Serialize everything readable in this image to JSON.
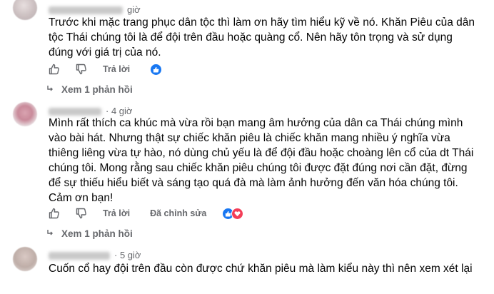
{
  "comments": [
    {
      "time": "giờ",
      "text": "Trước khi mặc trang phục dân tộc thì làm ơn hãy tìm hiểu kỹ về nó. Khăn Piêu của dân\ntộc Thái chúng tôi là để đội trên đầu hoặc quàng cổ. Nên hãy tôn trọng và sử dụng\nđúng với giá trị của nó.",
      "reply_label": "Trả lời",
      "view_replies": "Xem 1 phản hồi"
    },
    {
      "time": "· 4 giờ",
      "text": "Mình rất thích ca khúc mà vừa rồi bạn mang âm hưởng của dân ca Thái chúng mình\nvào bài hát. Nhưng thật sự chiếc khăn piêu là chiếc khăn mang nhiều ý nghĩa vừa\nthiêng liêng vừa tự hào, nó dùng chủ yếu là để đội đầu hoặc choàng lên cổ của dt Thái\nchúng tôi. Mong rằng sau chiếc khăn piêu chúng tôi được đặt đúng nơi cần đặt, đừng\nđể sự thiếu hiểu biết và sáng tạo quá đà mà làm ảnh hưởng đến văn hóa chúng tôi.\nCảm ơn bạn!",
      "reply_label": "Trả lời",
      "edited_label": "Đã chỉnh sửa",
      "view_replies": "Xem 1 phản hồi"
    },
    {
      "time": "· 5 giờ",
      "text": "Cuốn cổ hay đội trên đầu còn được chứ khăn piêu mà làm kiểu này thì nên xem xét lại"
    }
  ],
  "colors": {
    "like": "#1877f2",
    "love": "#f33e58",
    "meta": "#65676b"
  },
  "icons": [
    "thumbs-up-icon",
    "thumbs-down-icon",
    "like-reaction-icon",
    "love-reaction-icon",
    "reply-arrow-icon"
  ]
}
